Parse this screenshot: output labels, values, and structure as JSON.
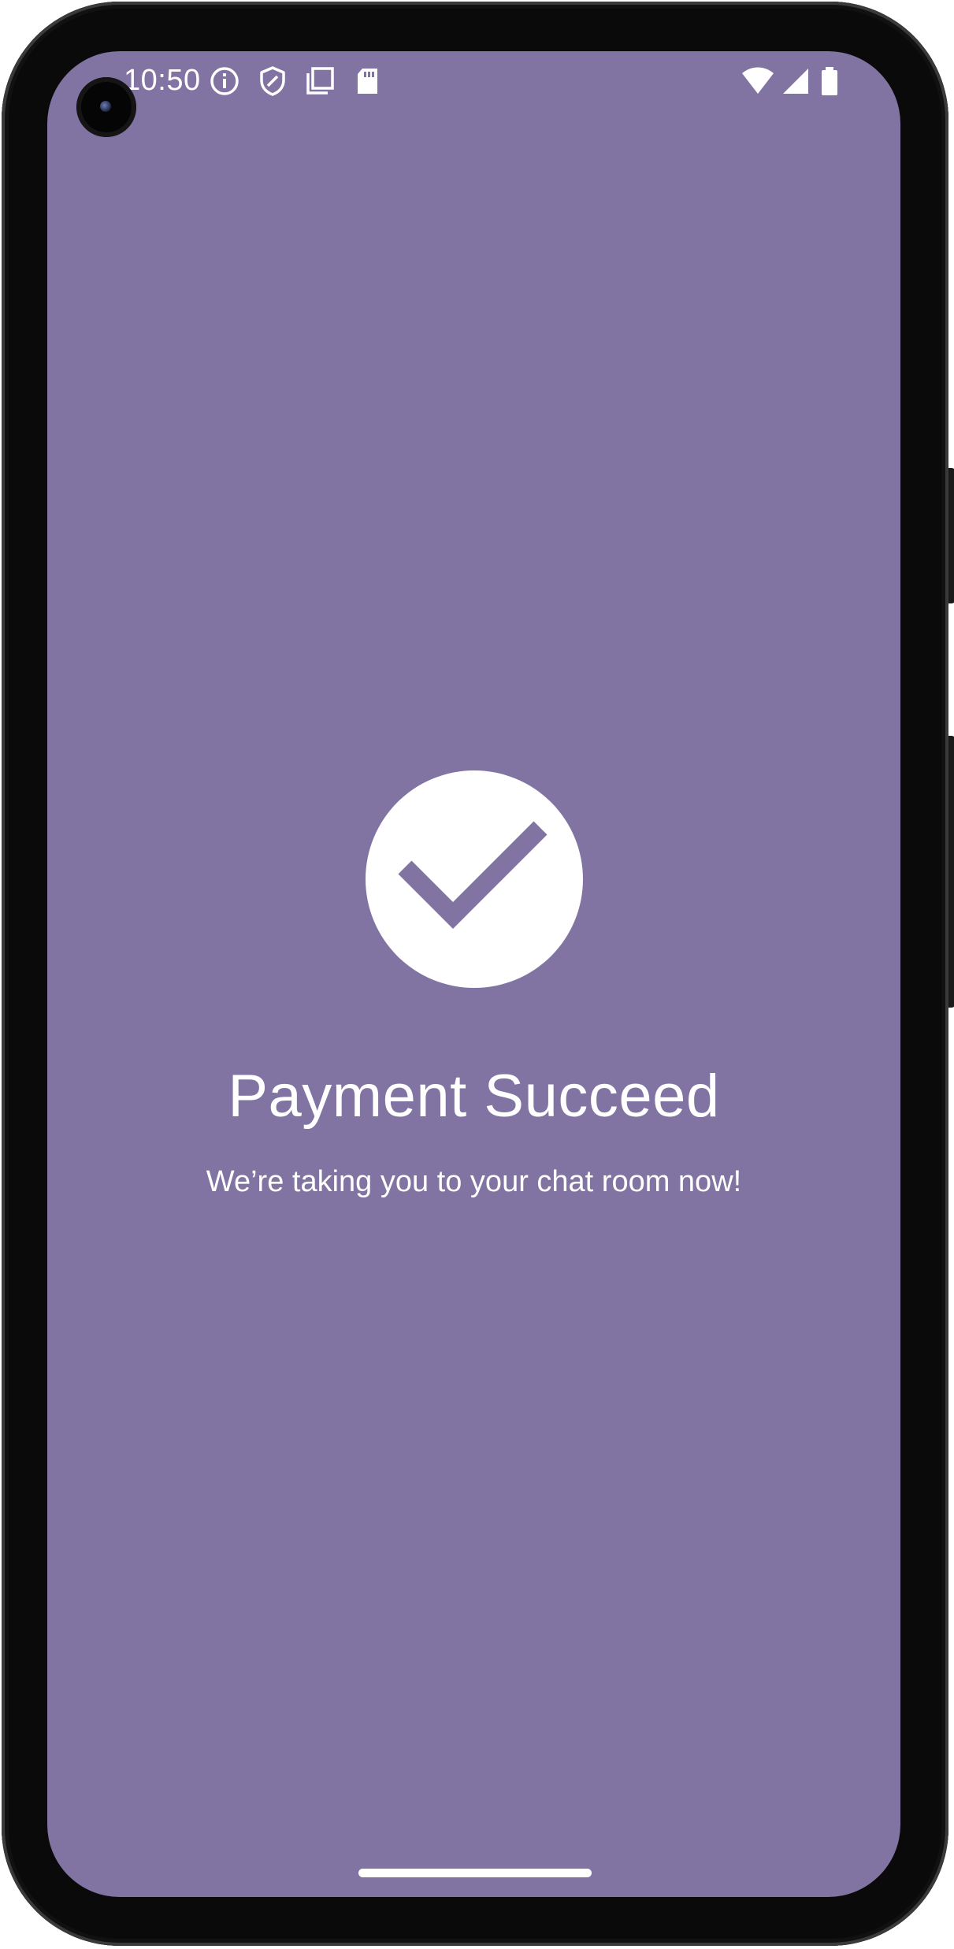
{
  "colors": {
    "screen_background": "#8174a3",
    "foreground": "#ffffff"
  },
  "status_bar": {
    "time": "10:50",
    "left_icons": [
      "info-icon",
      "shield-icon",
      "screen-record-icon",
      "sd-card-icon"
    ],
    "right_icons": [
      "wifi-icon",
      "cellular-signal-icon",
      "battery-icon"
    ]
  },
  "payment_result": {
    "icon": "check-circle-icon",
    "title": "Payment Succeed",
    "message": "We’re taking you to your chat room now!"
  }
}
